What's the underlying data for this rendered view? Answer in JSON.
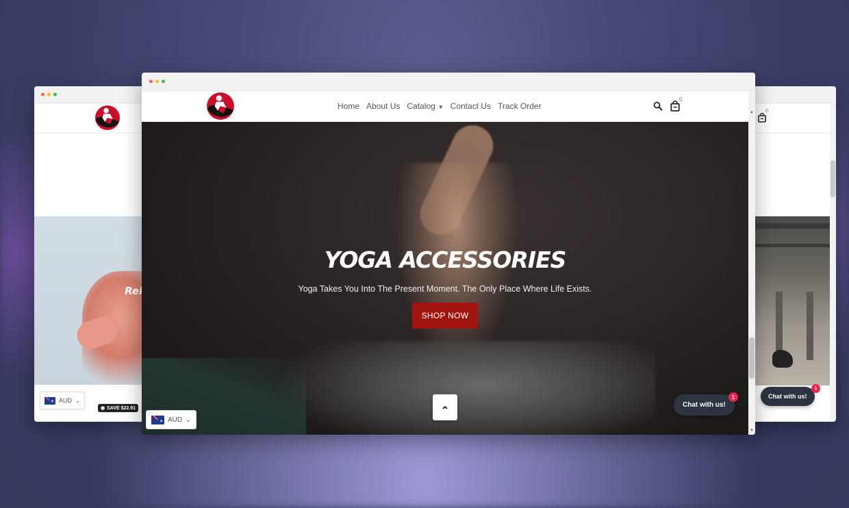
{
  "colors": {
    "accent": "#a1140f",
    "chat_bg": "#2d3340",
    "badge": "#e8274b",
    "dot_red": "#ff5f57",
    "dot_yellow": "#febc2e",
    "dot_green": "#28c840"
  },
  "left_window": {
    "hero_text": "Rel",
    "currency": "AUD",
    "save_badge": "SAVE $22.91"
  },
  "right_window": {
    "cart_count": "0",
    "chat_label": "Chat with us!",
    "chat_badge": "1"
  },
  "main_window": {
    "nav": {
      "items": [
        "Home",
        "About Us",
        "Catalog",
        "Contact Us",
        "Track Order"
      ]
    },
    "cart_count": "0",
    "hero": {
      "title": "YOGA ACCESSORIES",
      "subtitle": "Yoga Takes You Into The Present Moment. The Only Place Where Life Exists.",
      "button": "SHOP NOW"
    },
    "currency": "AUD",
    "chat_label": "Chat with us!",
    "chat_badge": "1"
  },
  "icons": [
    "logo-icon",
    "search-icon",
    "cart-icon",
    "chevron-down-icon",
    "chevron-up-icon",
    "tag-icon",
    "australia-flag-icon"
  ]
}
